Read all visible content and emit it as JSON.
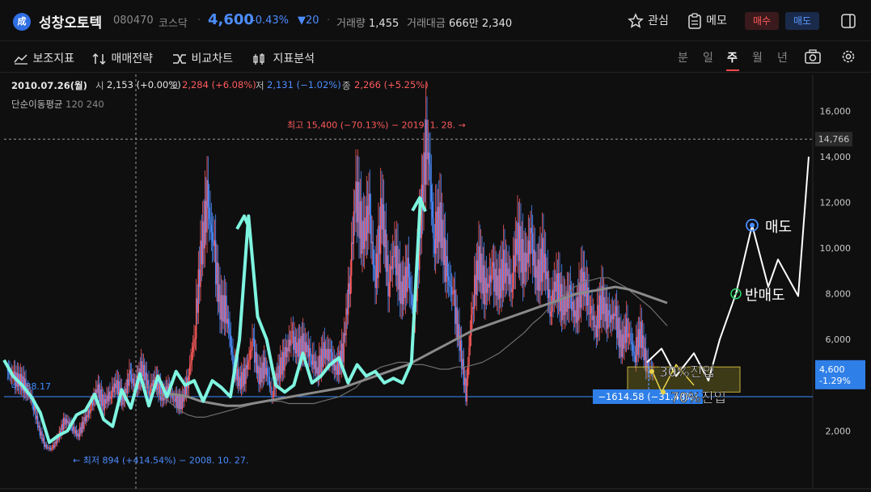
{
  "header": {
    "logo_glyph": "成",
    "stock_name": "성창오토텍",
    "stock_code": "080470",
    "market": "코스닥",
    "price": "4,600",
    "change_pct": "-0.43%",
    "change_amt": "▼20",
    "volume_label": "거래량",
    "volume_value": "1,455",
    "amount_label": "거래대금",
    "amount_value": "666만 2,340",
    "watch_label": "관심",
    "memo_label": "메모",
    "buy_label": "매수",
    "sell_label": "매도",
    "colors": {
      "up": "#ff5a5a",
      "down": "#4c8dff",
      "brand": "#2f6fe4"
    },
    "icons": {
      "watch": "star-icon",
      "memo": "clipboard-icon",
      "layout": "panel-icon"
    }
  },
  "toolbar": {
    "tools": [
      "보조지표",
      "매매전략",
      "비교차트",
      "지표분석"
    ],
    "tool_icons": [
      "indicator-icon",
      "strategy-icon",
      "compare-icon",
      "analysis-icon"
    ],
    "periods": [
      "분",
      "일",
      "주",
      "월",
      "년"
    ],
    "active_period": "주"
  },
  "ohlc": {
    "date": "2010.07.26(월)",
    "open_label": "시",
    "open": "2,153 (+0.00%)",
    "high_label": "고",
    "high": "2,284 (+6.08%)",
    "low_label": "저",
    "low": "2,131 (−1.02%)",
    "close_label": "종",
    "close": "2,266 (+5.25%)"
  },
  "ma_legend": {
    "label": "단순이동평균",
    "p1": "120",
    "p2": "240"
  },
  "chart_data": {
    "type": "line",
    "y_ticks": [
      2000,
      4000,
      6000,
      8000,
      10000,
      12000,
      14000,
      16000
    ],
    "y_tick_labels": [
      "2,000",
      "4,000",
      "6,000",
      "8,000",
      "10,000",
      "12,000",
      "14,000",
      "16,000"
    ],
    "ylim": [
      0,
      17600
    ],
    "price_tag": {
      "value": 4600,
      "label": "4,600",
      "pct": "-1.29%"
    },
    "crosshair_tag": {
      "value": 14766,
      "label": "14,766"
    },
    "support_line": {
      "value": 3500,
      "label": "4,888.17"
    },
    "max_annotation": {
      "value": 15400,
      "text": "최고 15,400 (−70.13%) − 2019. 1. 28. →"
    },
    "min_annotation": {
      "value": 894,
      "text": "← 최저 894 (+414.54%) − 2008. 10. 27."
    },
    "measure_label": "−1614.58 (−31.48%)",
    "entry_zone": {
      "top": 4800,
      "bottom": 3700
    },
    "annotations": [
      {
        "text": "30%진입",
        "value": 4600
      },
      {
        "text": "70%진입",
        "value": 3600
      },
      {
        "text": "반매도",
        "value": 8000
      },
      {
        "text": "매도",
        "value": 11000
      }
    ],
    "projection_path": [
      5000,
      5600,
      4400,
      5400,
      4200,
      6000,
      8000,
      11000,
      8300,
      9500,
      7900,
      14000
    ],
    "series": [
      {
        "color": "#ff5a5a",
        "values": [
          4700,
          4300,
          4200,
          3900,
          3300,
          2100,
          1300,
          1200,
          1700,
          2500,
          2200,
          1800,
          2400,
          3000,
          3800,
          3200,
          3600,
          4100,
          3300,
          4400,
          3900,
          4800,
          3800,
          4300,
          3500,
          3800,
          3300,
          3200,
          4200,
          6000,
          9600,
          12000,
          10000,
          7400,
          7300,
          5000,
          4100,
          4500,
          5900,
          4300,
          4900,
          3600,
          4600,
          5200,
          6100,
          5500,
          5800,
          5300,
          4600,
          5400,
          5300,
          4600,
          5500,
          8500,
          12600,
          10300,
          11600,
          8400,
          11800,
          8500,
          10000,
          7900,
          8900,
          6900,
          11300,
          15100,
          10500,
          11200,
          8900,
          7900,
          5900,
          3600,
          7600,
          9500,
          8000,
          8900,
          8200,
          9300,
          8400,
          10600,
          9000,
          10400,
          8500,
          9800,
          7400,
          8600,
          7300,
          7900,
          6900,
          8700,
          7600,
          6500,
          7700,
          6800,
          7100,
          5700,
          6600,
          5300,
          6300,
          4700,
          4600
        ]
      },
      {
        "color": "#6f6f6f",
        "values": [
          4200,
          4000,
          3800,
          3500,
          3200,
          2900,
          2700,
          2600,
          2600,
          2700,
          2800,
          2900,
          3000,
          3100,
          3200,
          3300,
          3300,
          3300,
          3200,
          3200,
          3200,
          3200,
          3300,
          3400,
          3500,
          3700,
          3900,
          4300,
          4600,
          4800,
          4900,
          5000,
          5000,
          4900,
          4900,
          4800,
          4700,
          4700,
          4800,
          4800,
          4900,
          5000,
          5200,
          5400,
          5700,
          6000,
          6300,
          6700,
          7000,
          7400,
          7700,
          8000,
          8300,
          8500,
          8600,
          8700,
          8700,
          8500,
          8300,
          8000,
          7700,
          7400,
          7000,
          6600
        ]
      },
      {
        "color": "#8a8a8a",
        "values": [
          3600,
          3600,
          3500,
          3300,
          3200,
          3100,
          3100,
          3200,
          3300,
          3400,
          3500,
          3600,
          3700,
          3800,
          3900,
          4100,
          4300,
          4500,
          4700,
          4900,
          5200,
          5500,
          5800,
          6100,
          6400,
          6600,
          6800,
          7000,
          7200,
          7400,
          7600,
          7800,
          8000,
          8100,
          8200,
          8300,
          8200,
          8000,
          7800,
          7600
        ]
      },
      {
        "color": "#7ff5e0",
        "values": [
          5100,
          4400,
          4000,
          3500,
          2800,
          1500,
          1800,
          2000,
          2700,
          2900,
          3600,
          2500,
          2200,
          3800,
          3000,
          4500,
          3100,
          4400,
          3500,
          4600,
          4000,
          4200,
          3300,
          4200,
          3900,
          3500,
          6000,
          11400,
          7000,
          6000,
          4000,
          3700,
          4000,
          5400,
          4100,
          4400,
          4900,
          5200,
          4100,
          4900,
          4400,
          4600,
          4100,
          4300,
          4100,
          5000,
          12200
        ]
      }
    ]
  }
}
